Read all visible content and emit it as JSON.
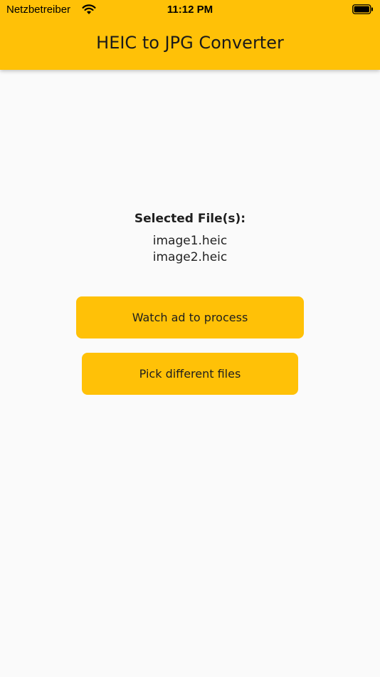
{
  "status_bar": {
    "carrier": "Netzbetreiber",
    "time": "11:12 PM",
    "wifi_icon": "wifi-icon",
    "battery_icon": "battery-icon"
  },
  "app_bar": {
    "title": "HEIC to JPG Converter",
    "color": "#ffc107"
  },
  "main": {
    "selected_label": "Selected File(s):",
    "files": [
      "image1.heic",
      "image2.heic"
    ],
    "watch_ad_button": "Watch ad to process",
    "pick_files_button": "Pick different files"
  },
  "colors": {
    "accent": "#ffc107",
    "background": "#fafafa"
  }
}
